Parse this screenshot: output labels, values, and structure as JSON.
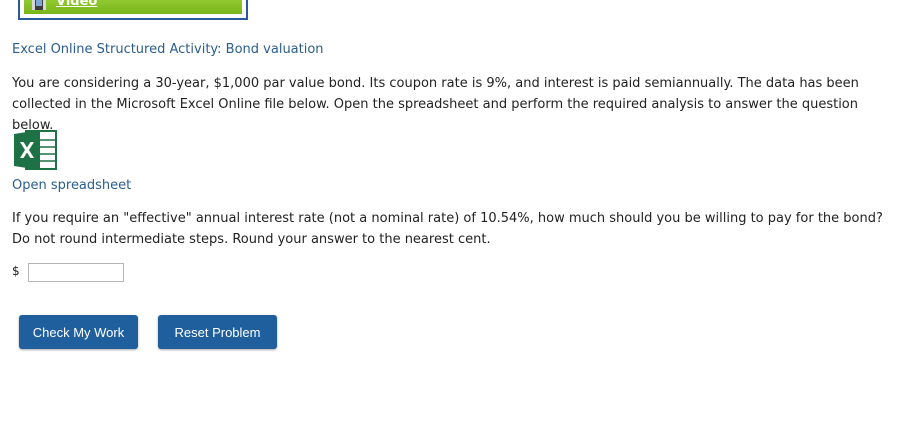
{
  "video": {
    "label": "Video",
    "icon": "film-icon"
  },
  "activity": {
    "title": "Excel Online Structured Activity: Bond valuation"
  },
  "intro": {
    "text": "You are considering a 30-year, $1,000 par value bond. Its coupon rate is 9%, and interest is paid semiannually. The data has been collected in the Microsoft Excel Online file below. Open the spreadsheet and perform the required analysis to answer the question below."
  },
  "spreadsheet": {
    "icon": "excel-icon",
    "link_label": "Open spreadsheet"
  },
  "question": {
    "text": "If you require an \"effective\" annual interest rate (not a nominal rate) of 10.54%, how much should you be willing to pay for the bond? Do not round intermediate steps. Round your answer to the nearest cent."
  },
  "answer": {
    "currency_symbol": "$",
    "value": ""
  },
  "buttons": {
    "check_label": "Check My Work",
    "reset_label": "Reset Problem"
  },
  "colors": {
    "link_blue": "#2a5d8f",
    "button_blue": "#1f5f9e",
    "video_green": "#8cc52a",
    "excel_green": "#1e7145"
  }
}
